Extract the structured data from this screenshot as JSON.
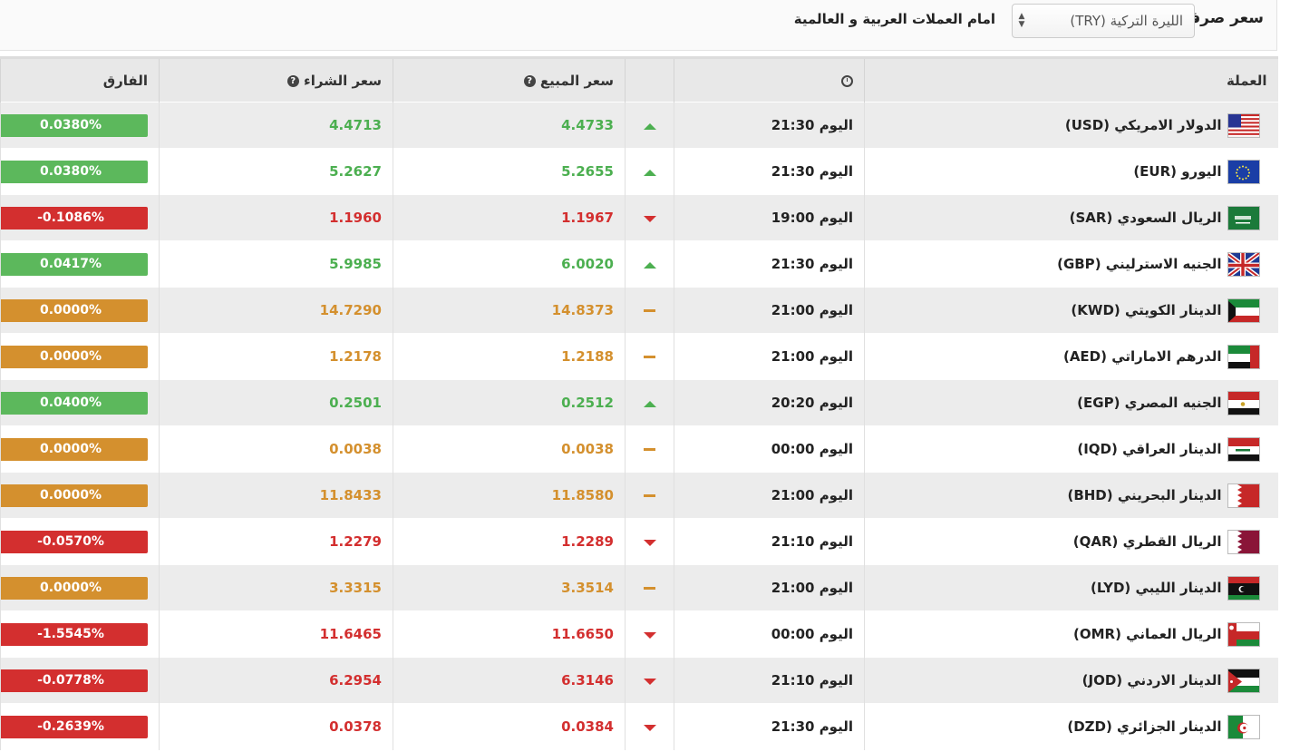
{
  "header": {
    "label": "سعر صرف",
    "selected_currency": "الليرة التركية (TRY)",
    "suffix": "امام العملات العربية و العالمية"
  },
  "table": {
    "columns": {
      "currency": "العملة",
      "sell": "سعر المبيع",
      "buy": "سعر الشراء",
      "diff": "الفارق"
    },
    "rows": [
      {
        "name": "الدولار الامريكي (USD)",
        "flag": "us",
        "time": "اليوم 21:30",
        "trend": "up",
        "sell": "4.4733",
        "buy": "4.4713",
        "diff": "0.0380%"
      },
      {
        "name": "اليورو (EUR)",
        "flag": "eu",
        "time": "اليوم 21:30",
        "trend": "up",
        "sell": "5.2655",
        "buy": "5.2627",
        "diff": "0.0380%"
      },
      {
        "name": "الريال السعودي (SAR)",
        "flag": "sa",
        "time": "اليوم 19:00",
        "trend": "down",
        "sell": "1.1967",
        "buy": "1.1960",
        "diff": "-0.1086%"
      },
      {
        "name": "الجنيه الاسترليني (GBP)",
        "flag": "gb",
        "time": "اليوم 21:30",
        "trend": "up",
        "sell": "6.0020",
        "buy": "5.9985",
        "diff": "0.0417%"
      },
      {
        "name": "الدينار الكويتي (KWD)",
        "flag": "kw",
        "time": "اليوم 21:00",
        "trend": "flat",
        "sell": "14.8373",
        "buy": "14.7290",
        "diff": "0.0000%"
      },
      {
        "name": "الدرهم الاماراتي (AED)",
        "flag": "ae",
        "time": "اليوم 21:00",
        "trend": "flat",
        "sell": "1.2188",
        "buy": "1.2178",
        "diff": "0.0000%"
      },
      {
        "name": "الجنيه المصري (EGP)",
        "flag": "eg",
        "time": "اليوم 20:20",
        "trend": "up",
        "sell": "0.2512",
        "buy": "0.2501",
        "diff": "0.0400%"
      },
      {
        "name": "الدينار العراقي (IQD)",
        "flag": "iq",
        "time": "اليوم 00:00",
        "trend": "flat",
        "sell": "0.0038",
        "buy": "0.0038",
        "diff": "0.0000%"
      },
      {
        "name": "الدينار البحريني (BHD)",
        "flag": "bh",
        "time": "اليوم 21:00",
        "trend": "flat",
        "sell": "11.8580",
        "buy": "11.8433",
        "diff": "0.0000%"
      },
      {
        "name": "الريال القطري (QAR)",
        "flag": "qa",
        "time": "اليوم 21:10",
        "trend": "down",
        "sell": "1.2289",
        "buy": "1.2279",
        "diff": "-0.0570%"
      },
      {
        "name": "الدينار الليبي (LYD)",
        "flag": "ly",
        "time": "اليوم 21:00",
        "trend": "flat",
        "sell": "3.3514",
        "buy": "3.3315",
        "diff": "0.0000%"
      },
      {
        "name": "الريال العماني (OMR)",
        "flag": "om",
        "time": "اليوم 00:00",
        "trend": "down",
        "sell": "11.6650",
        "buy": "11.6465",
        "diff": "-1.5545%"
      },
      {
        "name": "الدينار الاردني (JOD)",
        "flag": "jo",
        "time": "اليوم 21:10",
        "trend": "down",
        "sell": "6.3146",
        "buy": "6.2954",
        "diff": "-0.0778%"
      },
      {
        "name": "الدينار الجزائري (DZD)",
        "flag": "dz",
        "time": "اليوم 21:30",
        "trend": "down",
        "sell": "0.0384",
        "buy": "0.0378",
        "diff": "-0.2639%"
      }
    ]
  },
  "colors": {
    "up": "#5cb85c",
    "down": "#d32f2f",
    "flat": "#d4902e"
  }
}
